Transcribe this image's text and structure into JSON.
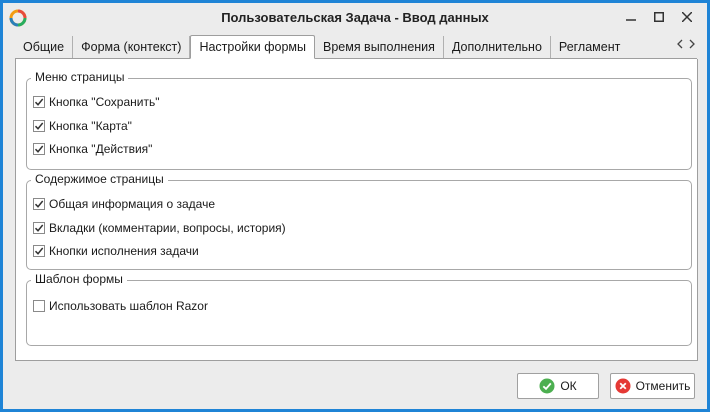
{
  "window": {
    "title": "Пользовательская Задача - Ввод данных"
  },
  "tabs": [
    {
      "label": "Общие"
    },
    {
      "label": "Форма (контекст)"
    },
    {
      "label": "Настройки формы",
      "active": true
    },
    {
      "label": "Время выполнения"
    },
    {
      "label": "Дополнительно"
    },
    {
      "label": "Регламент"
    }
  ],
  "groups": {
    "page_menu": {
      "title": "Меню страницы",
      "items": [
        {
          "label": "Кнопка \"Сохранить\"",
          "checked": true
        },
        {
          "label": "Кнопка \"Карта\"",
          "checked": true
        },
        {
          "label": "Кнопка \"Действия\"",
          "checked": true
        }
      ]
    },
    "page_content": {
      "title": "Содержимое страницы",
      "items": [
        {
          "label": "Общая информация о задаче",
          "checked": true
        },
        {
          "label": "Вкладки (комментарии, вопросы, история)",
          "checked": true
        },
        {
          "label": "Кнопки исполнения задачи",
          "checked": true
        }
      ]
    },
    "form_template": {
      "title": "Шаблон формы",
      "items": [
        {
          "label": "Использовать шаблон Razor",
          "checked": false
        }
      ]
    }
  },
  "footer": {
    "ok_label": "ОК",
    "cancel_label": "Отменить"
  },
  "colors": {
    "window_border": "#1f84d6",
    "ok_icon": "#4caf50",
    "cancel_icon": "#e53935"
  }
}
